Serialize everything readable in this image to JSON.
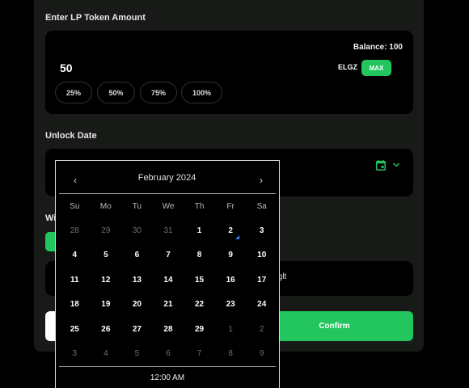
{
  "form": {
    "amount_label": "Enter LP Token Amount",
    "balance": "Balance: 100",
    "amount_value": "50",
    "token": "ELGZ",
    "max_label": "MAX",
    "percent_buttons": [
      "25%",
      "50%",
      "75%",
      "100%"
    ],
    "unlock_label": "Unlock Date",
    "partial_label": "Wi",
    "partial_row_text": "ıglt",
    "confirm_label": "Confirm"
  },
  "icons": {
    "calendar": "calendar-icon",
    "chevron": "chevron-down-icon",
    "prev": "chevron-left-icon",
    "next": "chevron-right-icon"
  },
  "colors": {
    "accent": "#22c55e",
    "today_marker": "#3b82f6"
  },
  "calendar": {
    "prev": "‹",
    "next": "›",
    "title": "February 2024",
    "weekdays": [
      "Su",
      "Mo",
      "Tu",
      "We",
      "Th",
      "Fr",
      "Sa"
    ],
    "weeks": [
      [
        "28",
        "29",
        "30",
        "31",
        "1",
        "2",
        "3"
      ],
      [
        "4",
        "5",
        "6",
        "7",
        "8",
        "9",
        "10"
      ],
      [
        "11",
        "12",
        "13",
        "14",
        "15",
        "16",
        "17"
      ],
      [
        "18",
        "19",
        "20",
        "21",
        "22",
        "23",
        "24"
      ],
      [
        "25",
        "26",
        "27",
        "28",
        "29",
        "1",
        "2"
      ],
      [
        "3",
        "4",
        "5",
        "6",
        "7",
        "8",
        "9"
      ]
    ],
    "outside_month": [
      [
        true,
        true,
        true,
        true,
        false,
        false,
        false
      ],
      [
        false,
        false,
        false,
        false,
        false,
        false,
        false
      ],
      [
        false,
        false,
        false,
        false,
        false,
        false,
        false
      ],
      [
        false,
        false,
        false,
        false,
        false,
        false,
        false
      ],
      [
        false,
        false,
        false,
        false,
        false,
        true,
        true
      ],
      [
        true,
        true,
        true,
        true,
        true,
        true,
        true
      ]
    ],
    "marked_day": "2",
    "time": "12:00 AM"
  }
}
